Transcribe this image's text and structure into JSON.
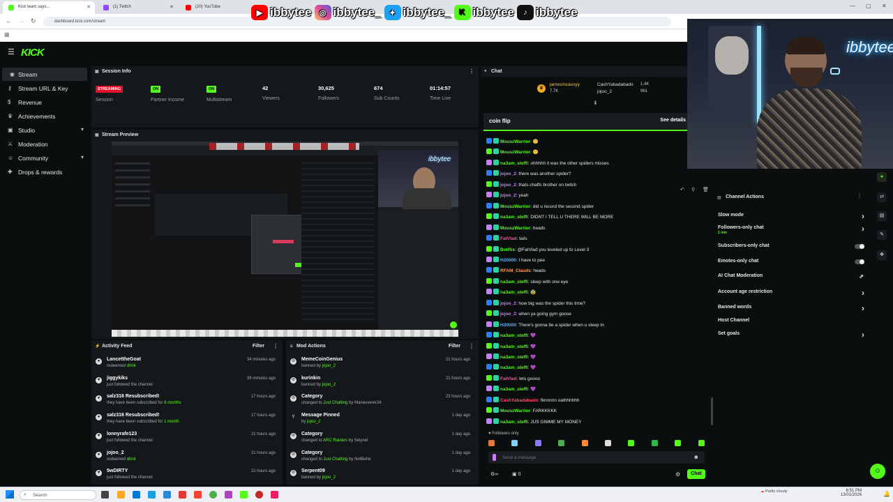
{
  "browser": {
    "tabs": [
      {
        "title": "Kick team says...",
        "color": "#53fc18"
      },
      {
        "title": "(1) Twitch",
        "color": "#9146ff"
      },
      {
        "title": "(20) YouTube",
        "color": "#ff0000"
      }
    ],
    "url": "dashboard.kick.com/stream"
  },
  "overlay": {
    "socials": [
      {
        "icon": "youtube-icon",
        "handle": "ibbytee",
        "color": "#ff0000"
      },
      {
        "icon": "instagram-icon",
        "handle": "ibbytee_",
        "color": "#d6249f"
      },
      {
        "icon": "twitter-icon",
        "handle": "ibbytee_",
        "color": "#1da1f2"
      },
      {
        "icon": "kick-icon",
        "handle": "ibbytee",
        "color": "#53fc18"
      },
      {
        "icon": "tiktok-icon",
        "handle": "ibbytee",
        "color": "#111111"
      }
    ],
    "webcam_logo": "ibbytee"
  },
  "app": {
    "logo": "KICK",
    "accent": "#53fc18"
  },
  "sidebar": {
    "items": [
      {
        "label": "Stream",
        "icon": "broadcast-icon"
      },
      {
        "label": "Stream URL & Key",
        "icon": "key-icon"
      },
      {
        "label": "Revenue",
        "icon": "dollar-icon"
      },
      {
        "label": "Achievements",
        "icon": "trophy-icon"
      },
      {
        "label": "Studio",
        "icon": "studio-icon"
      },
      {
        "label": "Moderation",
        "icon": "sword-icon"
      },
      {
        "label": "Community",
        "icon": "users-icon"
      },
      {
        "label": "Drops & rewards",
        "icon": "gift-icon"
      }
    ]
  },
  "session": {
    "title": "Session Info",
    "stats": [
      {
        "value": "STREAMING",
        "label": "Session"
      },
      {
        "value": "ON",
        "label": "Partner Income"
      },
      {
        "value": "ON",
        "label": "Multistream"
      },
      {
        "value": "42",
        "label": "Viewers"
      },
      {
        "value": "30,625",
        "label": "Followers"
      },
      {
        "value": "674",
        "label": "Sub Counts"
      },
      {
        "value": "01:14:57",
        "label": "Time Live"
      }
    ]
  },
  "preview": {
    "title": "Stream Preview"
  },
  "activity": {
    "title": "Activity Feed",
    "filter": "Filter",
    "items": [
      {
        "name": "LancettheGoat",
        "desc": "redeemed",
        "hl": "drink",
        "time": "34 minutes ago"
      },
      {
        "name": "jiggykiks",
        "desc": "just followed the channel",
        "hl": "",
        "time": "39 minutes ago"
      },
      {
        "name": "salz316 Resubscribed!",
        "desc": "they have been subscribed for",
        "hl": "8 months",
        "time": "17 hours ago"
      },
      {
        "name": "salz316 Resubscribed!",
        "desc": "they have been subscribed for",
        "hl": "1 month",
        "time": "17 hours ago"
      },
      {
        "name": "lonnyrafe123",
        "desc": "just followed the channel",
        "hl": "",
        "time": "21 hours ago"
      },
      {
        "name": "jojoo_2",
        "desc": "redeemed",
        "hl": "drink",
        "time": "21 hours ago"
      },
      {
        "name": "5wDIRTY",
        "desc": "just followed the channel",
        "hl": "",
        "time": "21 hours ago"
      }
    ]
  },
  "mod": {
    "title": "Mod Actions",
    "filter": "Filter",
    "items": [
      {
        "name": "MemeCoinGenius",
        "desc": "banned by",
        "hl": "jojoo_2",
        "time": "21 hours ago"
      },
      {
        "name": "kurinkin",
        "desc": "banned by",
        "hl": "jojoo_2",
        "time": "21 hours ago"
      },
      {
        "name": "Category",
        "desc": "changed to",
        "hl": "Just Chatting",
        "by": "by Maneuverer24",
        "time": "23 hours ago"
      },
      {
        "name": "Message Pinned",
        "desc": "by",
        "hl": "jojoo_2",
        "time": "1 day ago"
      },
      {
        "name": "Category",
        "desc": "changed to",
        "hl": "ARC Raiders",
        "by": "by Selynel",
        "time": "1 day ago"
      },
      {
        "name": "Category",
        "desc": "changed to",
        "hl": "Just Chatting",
        "by": "by NotBehd",
        "time": "1 day ago"
      },
      {
        "name": "Serpent09",
        "desc": "banned by",
        "hl": "jojoo_2",
        "time": "1 day ago"
      }
    ]
  },
  "chat": {
    "title": "Chat",
    "top_gifters": [
      {
        "name": "jamesmcavoyy",
        "amount": "7.7K"
      },
      {
        "name": "CashYabadabado",
        "amount": "1.4K"
      },
      {
        "name": "jojoo_2",
        "amount": "961"
      }
    ],
    "coinflip": {
      "label": "coin flip",
      "details": "See details"
    },
    "messages": [
      {
        "user": "MouszWarrior",
        "text": "🙂",
        "color": "#53fc18"
      },
      {
        "user": "MouszWarrior",
        "text": "🙂",
        "color": "#53fc18"
      },
      {
        "user": "na3am_steffi",
        "text": "ohhhhh it was the other spiders misses",
        "color": "#53fc18"
      },
      {
        "user": "jojoo_2",
        "text": "there was another spider?",
        "color": "#c77dff"
      },
      {
        "user": "jojoo_2",
        "text": "thats chaffs brother on twitch",
        "color": "#c77dff"
      },
      {
        "user": "jojoo_2",
        "text": "yeah",
        "color": "#c77dff"
      },
      {
        "user": "MouszWarrior",
        "text": "did u record the second spider",
        "color": "#53fc18"
      },
      {
        "user": "na3am_steffi",
        "text": "DIDNT I TELL U THERE WILL BE MORE",
        "color": "#53fc18"
      },
      {
        "user": "MouszWarrior",
        "text": "heads",
        "color": "#53fc18"
      },
      {
        "user": "FatVlad",
        "text": "tails",
        "color": "#ff4d9e"
      },
      {
        "user": "BotRix",
        "text": "@FatVlad you leveled up to Level 3",
        "color": "#53fc18"
      },
      {
        "user": "H20000",
        "text": "I have to pee",
        "color": "#5dadff"
      },
      {
        "user": "RFAM_Clauds",
        "text": "heads",
        "color": "#ff9d5c"
      },
      {
        "user": "na3am_steffi",
        "text": "sleep with one eye",
        "color": "#53fc18"
      },
      {
        "user": "na3am_steffi",
        "text": "🥸",
        "color": "#53fc18"
      },
      {
        "user": "jojoo_2",
        "text": "how big was the spider this time?",
        "color": "#c77dff"
      },
      {
        "user": "jojoo_2",
        "text": "when ya going gym goose",
        "color": "#c77dff"
      },
      {
        "user": "H20000",
        "text": "There's gonna be a spider when u sleep tn",
        "color": "#5dadff"
      },
      {
        "user": "na3am_steffi",
        "text": "💜",
        "color": "#53fc18"
      },
      {
        "user": "na3am_steffi",
        "text": "💜",
        "color": "#53fc18"
      },
      {
        "user": "na3am_steffi",
        "text": "💜",
        "color": "#53fc18"
      },
      {
        "user": "na3am_steffi",
        "text": "💜",
        "color": "#53fc18"
      },
      {
        "user": "FatVlad",
        "text": "lets goooo",
        "color": "#ff4d9e"
      },
      {
        "user": "na3am_steffi",
        "text": "💜",
        "color": "#53fc18"
      },
      {
        "user": "CashYabadabado",
        "text": "fknnnnn oathhhhhh",
        "color": "#ff4d6d"
      },
      {
        "user": "MouszWarrior",
        "text": "FARKKKKK",
        "color": "#53fc18"
      },
      {
        "user": "na3am_steffi",
        "text": "JUS GIMME MY MONEY",
        "color": "#53fc18"
      }
    ],
    "followers_only": "Followers only",
    "placeholder": "Send a message",
    "points": "0",
    "send": "Chat"
  },
  "channel_actions": {
    "title": "Channel Actions",
    "items": [
      {
        "label": "Slow mode",
        "sub": "",
        "control": "arrow"
      },
      {
        "label": "Followers-only chat",
        "sub": "1 min",
        "control": "arrow"
      },
      {
        "label": "Subscribers-only chat",
        "sub": "",
        "control": "toggle"
      },
      {
        "label": "Emotes-only chat",
        "sub": "",
        "control": "toggle"
      },
      {
        "label": "AI Chat Moderation",
        "sub": "",
        "control": "external"
      },
      {
        "label": "Account age restriction",
        "sub": "",
        "control": "arrow"
      },
      {
        "label": "Banned words",
        "sub": "",
        "control": "arrow"
      },
      {
        "label": "Host Channel",
        "sub": "",
        "control": "none"
      },
      {
        "label": "Set goals",
        "sub": "",
        "control": "arrow"
      }
    ]
  },
  "taskbar": {
    "search": "Search",
    "weather": "Partly cloudy",
    "time": "6:51 PM",
    "date": "13/01/2026"
  }
}
